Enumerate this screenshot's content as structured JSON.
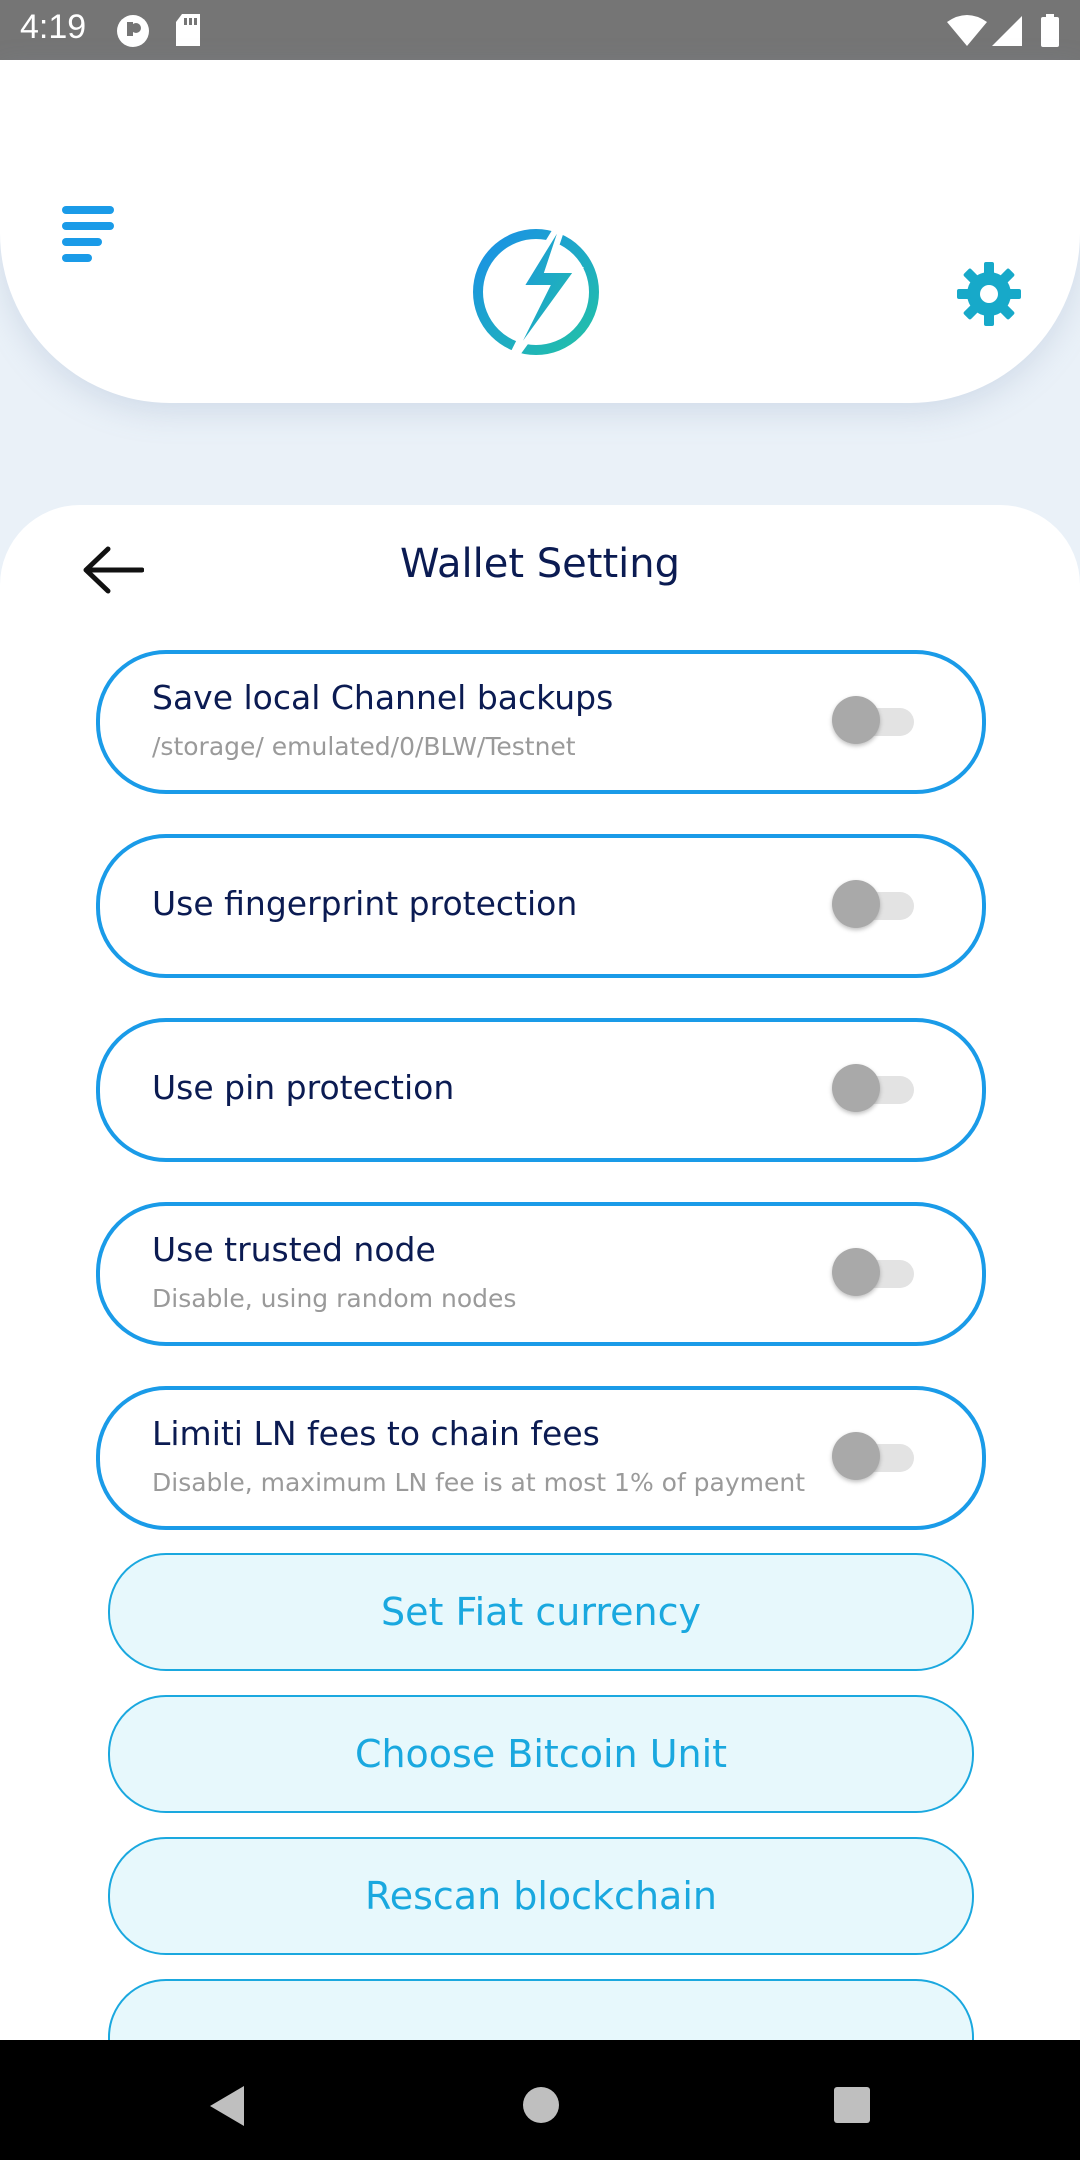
{
  "status_bar": {
    "time": "4:19"
  },
  "page": {
    "title": "Wallet Setting"
  },
  "toggles": [
    {
      "label": "Save local Channel backups",
      "subtitle": "/storage/ emulated/0/BLW/Testnet",
      "enabled": false
    },
    {
      "label": "Use fingerprint protection",
      "subtitle": "",
      "enabled": false
    },
    {
      "label": "Use pin protection",
      "subtitle": "",
      "enabled": false
    },
    {
      "label": "Use trusted node",
      "subtitle": "Disable, using random nodes",
      "enabled": false
    },
    {
      "label": "Limiti LN fees to chain fees",
      "subtitle": "Disable, maximum LN fee is at most 1% of payment",
      "enabled": false
    }
  ],
  "buttons": [
    {
      "label": "Set Fiat currency"
    },
    {
      "label": "Choose Bitcoin Unit"
    },
    {
      "label": "Rescan blockchain"
    }
  ],
  "colors": {
    "accent": "#1a9be8",
    "title_text": "#0b1b52",
    "button_bg": "#e7f8fc",
    "button_text": "#1aa8df"
  }
}
